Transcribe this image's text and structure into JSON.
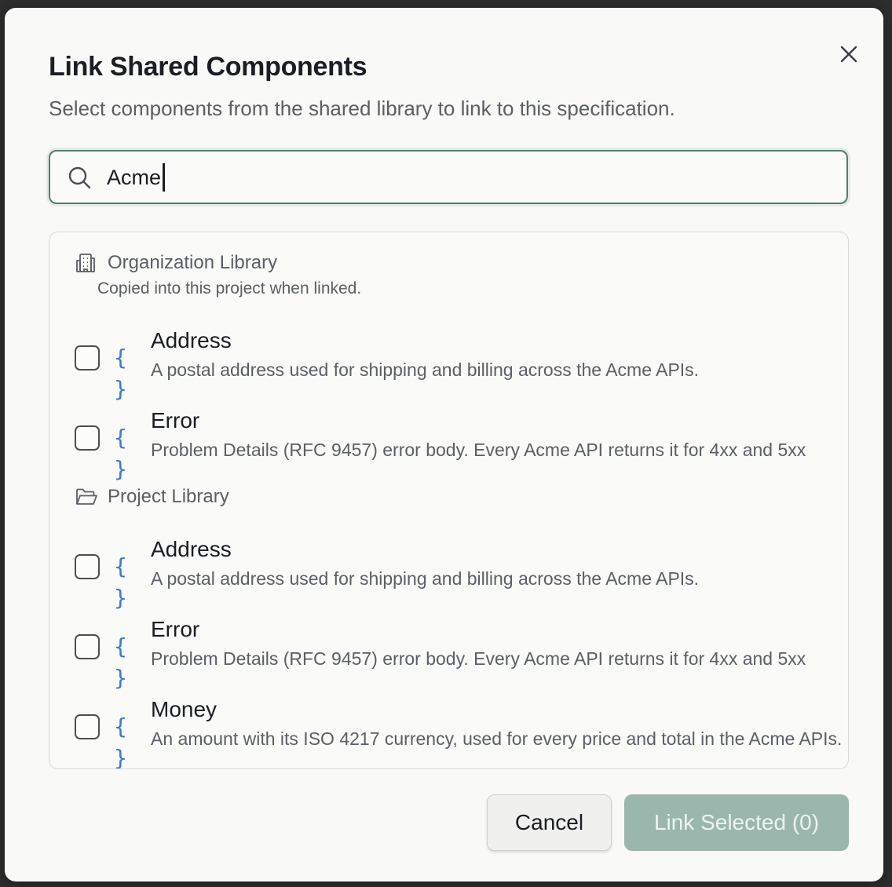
{
  "dialog": {
    "title": "Link Shared Components",
    "subtitle": "Select components from the shared library to link to this specification.",
    "close_icon": "close-icon"
  },
  "search": {
    "value": "Acme",
    "icon": "search-icon"
  },
  "groups": [
    {
      "label": "Organization Library",
      "description": "Copied into this project when linked.",
      "icon": "building-icon",
      "items": [
        {
          "name": "Address",
          "description": "A postal address used for shipping and billing across the Acme APIs.",
          "checked": false
        },
        {
          "name": "Error",
          "description": "Problem Details (RFC 9457) error body. Every Acme API returns it for 4xx and 5xx",
          "checked": false
        }
      ]
    },
    {
      "label": "Project Library",
      "icon": "folder-open-icon",
      "items": [
        {
          "name": "Address",
          "description": "A postal address used for shipping and billing across the Acme APIs.",
          "checked": false
        },
        {
          "name": "Error",
          "description": "Problem Details (RFC 9457) error body. Every Acme API returns it for 4xx and 5xx",
          "checked": false
        },
        {
          "name": "Money",
          "description": "An amount with its ISO 4217 currency, used for every price and total in the Acme APIs.",
          "checked": false
        }
      ]
    }
  ],
  "item_icon_text": "{ }",
  "footer": {
    "cancel_label": "Cancel",
    "link_label": "Link Selected (0)"
  },
  "colors": {
    "accent": "#4f7f70",
    "primary_disabled": "#9bb6ad",
    "brace_blue": "#3a7ad8"
  }
}
